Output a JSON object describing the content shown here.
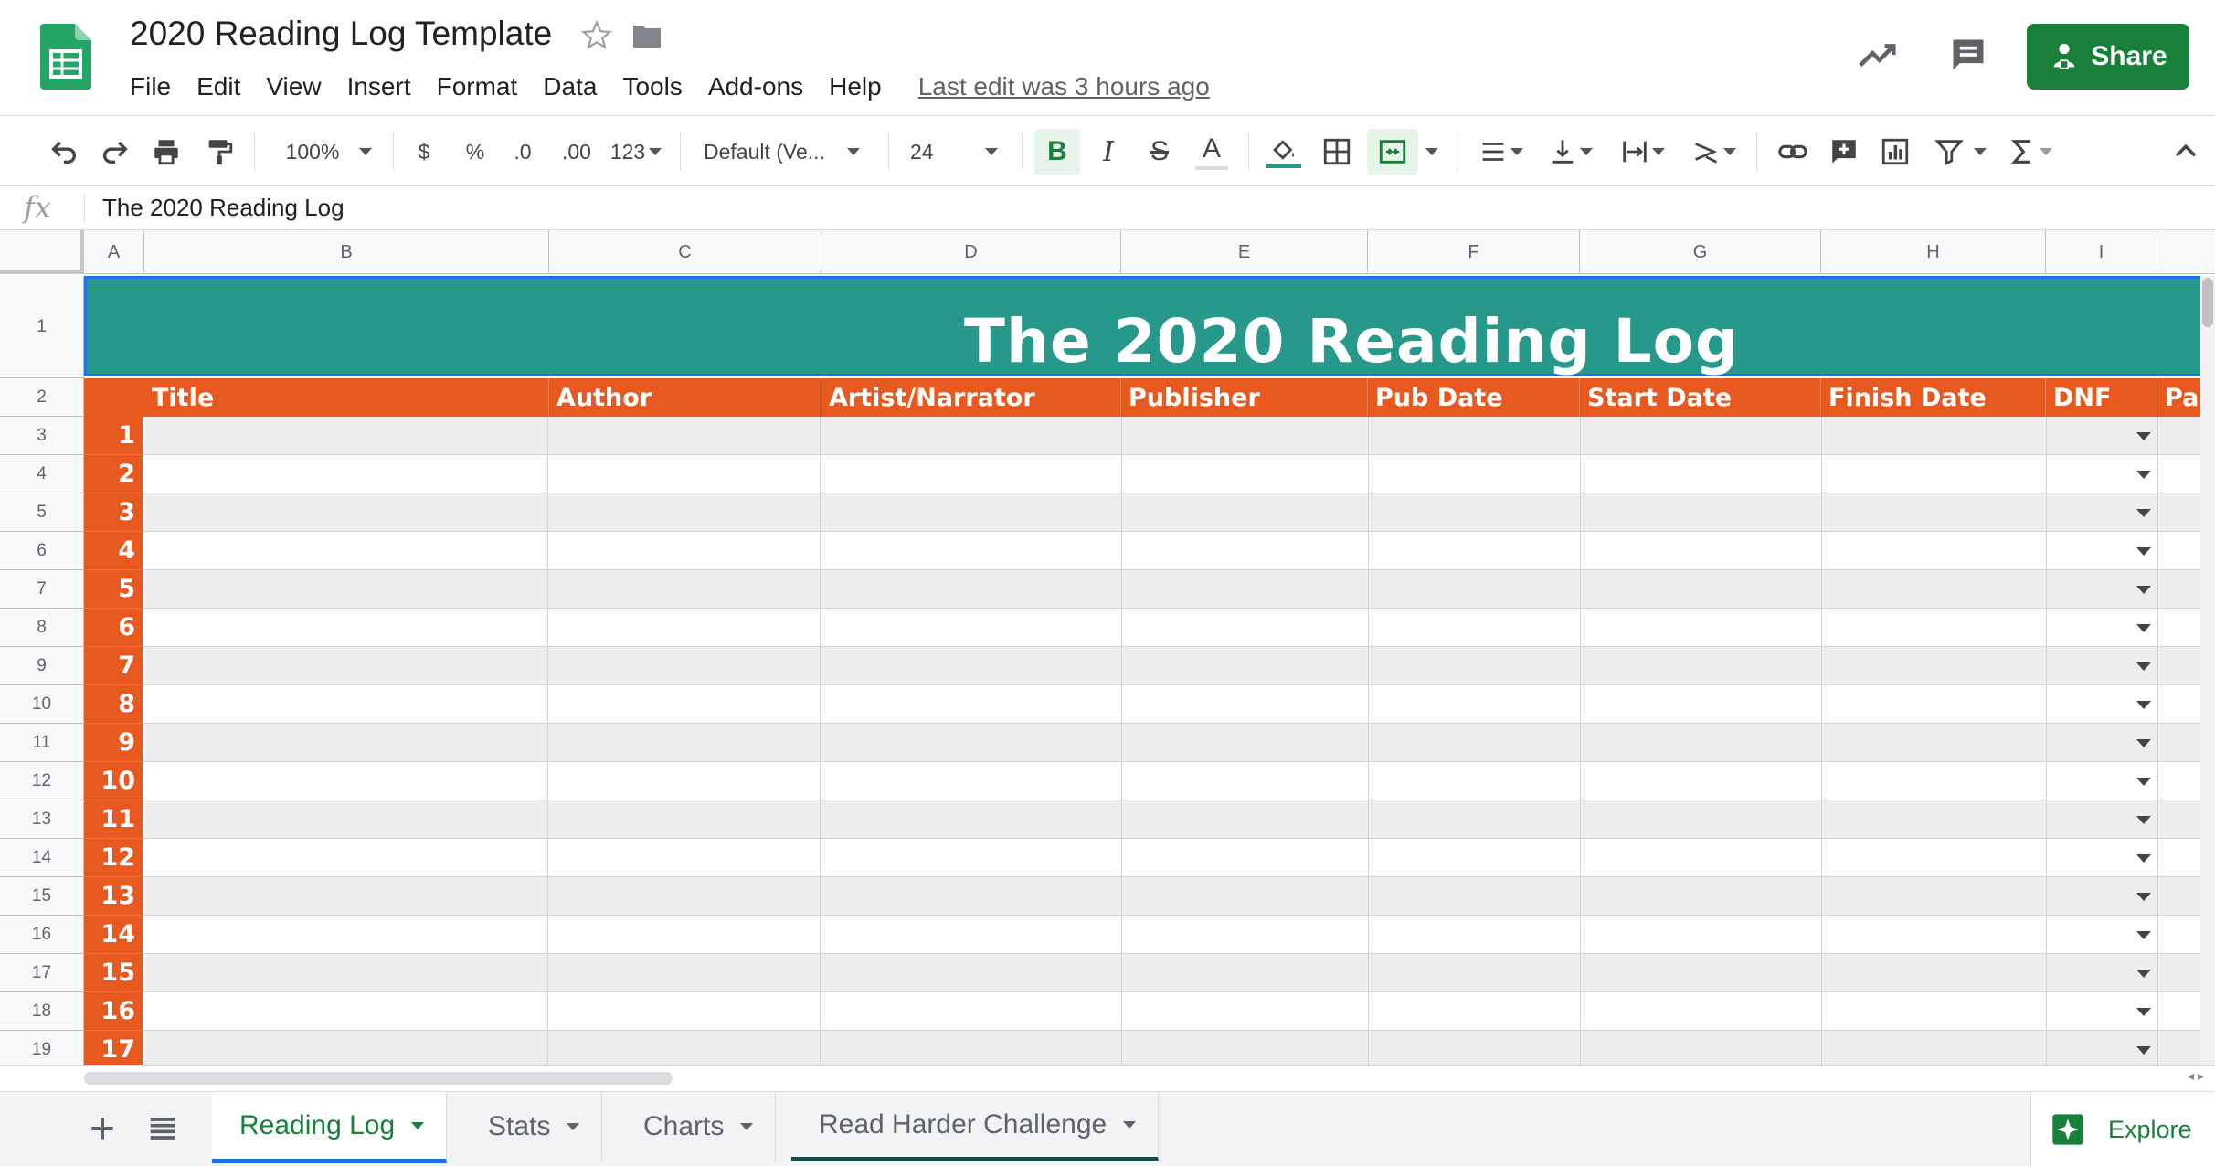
{
  "document": {
    "title": "2020 Reading Log Template",
    "last_edit": "Last edit was 3 hours ago"
  },
  "menu": [
    "File",
    "Edit",
    "View",
    "Insert",
    "Format",
    "Data",
    "Tools",
    "Add-ons",
    "Help"
  ],
  "share_label": "Share",
  "toolbar": {
    "zoom": "100%",
    "currency": "$",
    "percent": "%",
    "decrease_decimals": ".0",
    "increase_decimals": ".00",
    "more_formats": "123",
    "font": "Default (Ve...",
    "font_size": "24",
    "bold": "B",
    "italic": "I",
    "strike": "S",
    "text_color": "A"
  },
  "formula": {
    "fx_label": "fx",
    "value": "The 2020 Reading Log"
  },
  "columns": [
    "A",
    "B",
    "C",
    "D",
    "E",
    "F",
    "G",
    "H",
    "I"
  ],
  "rows": [
    "1",
    "2",
    "3",
    "4",
    "5",
    "6",
    "7",
    "8",
    "9",
    "10",
    "11",
    "12",
    "13",
    "14",
    "15",
    "16",
    "17",
    "18",
    "19"
  ],
  "sheet": {
    "banner": "The 2020 Reading Log",
    "headers": [
      "Title",
      "Author",
      "Artist/Narrator",
      "Publisher",
      "Pub Date",
      "Start Date",
      "Finish Date",
      "DNF",
      "Pa"
    ],
    "book_numbers": [
      "1",
      "2",
      "3",
      "4",
      "5",
      "6",
      "7",
      "8",
      "9",
      "10",
      "11",
      "12",
      "13",
      "14",
      "15",
      "16",
      "17"
    ]
  },
  "tabs": [
    {
      "label": "Reading Log",
      "active": true
    },
    {
      "label": "Stats",
      "active": false
    },
    {
      "label": "Charts",
      "active": false
    },
    {
      "label": "Read Harder Challenge",
      "active": false
    }
  ],
  "explore_label": "Explore",
  "colors": {
    "banner": "#26998a",
    "header": "#e8591f",
    "share": "#188038",
    "selection": "#1a73e8"
  }
}
